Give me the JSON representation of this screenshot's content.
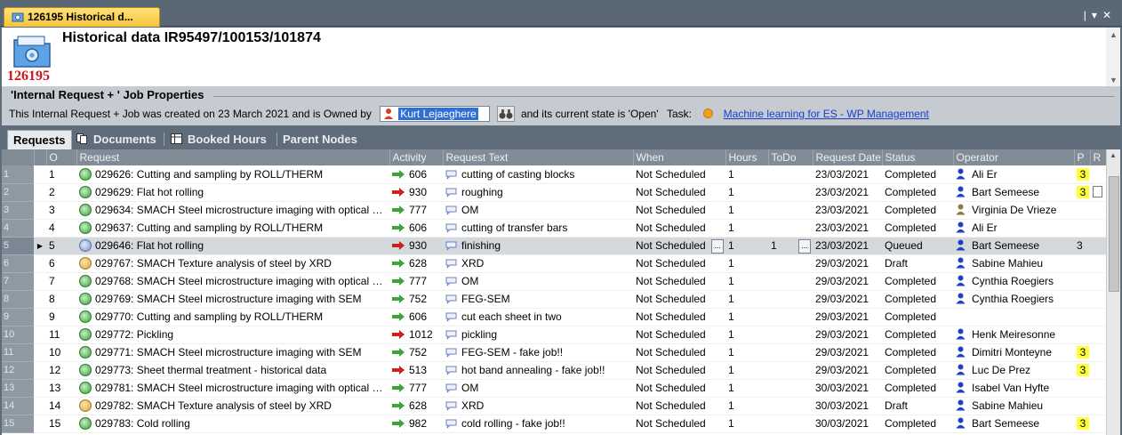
{
  "tab": {
    "label": "126195 Historical d..."
  },
  "header": {
    "title": "Historical data IR95497/100153/101874",
    "record_id": "126195"
  },
  "props": {
    "legend": "'Internal Request + ' Job Properties",
    "sentence_pre": "This Internal Request + Job was created on 23 March 2021 and is Owned by",
    "owner": "Kurt Lejaeghere",
    "sentence_post": "and its current state is 'Open'",
    "task_label": "Task:",
    "task_link": "Machine learning for ES - WP Management"
  },
  "section_tabs": [
    {
      "label": "Requests"
    },
    {
      "label": "Documents"
    },
    {
      "label": "Booked Hours"
    },
    {
      "label": "Parent Nodes"
    }
  ],
  "columns": [
    "O",
    "Request",
    "Activity",
    "Request Text",
    "When",
    "Hours",
    "ToDo",
    "Request Date",
    "Status",
    "Operator",
    "P",
    "R"
  ],
  "colors": {
    "arrow_green": "#3ea53e",
    "arrow_red": "#d0201a",
    "badge_yellow": "#ffff3c",
    "id_red": "#d0141c"
  },
  "rows": [
    {
      "n": "1",
      "o": "1",
      "req": "029626: Cutting and sampling by ROLL/THERM",
      "st_icon": "completed",
      "act": "606",
      "act_dir": "green",
      "text": "cutting of casting blocks",
      "when": "Not Scheduled",
      "hours": "1",
      "todo": "",
      "date": "23/03/2021",
      "status": "Completed",
      "op": "Ali Er",
      "op_color": "blue",
      "p": "3",
      "r": ""
    },
    {
      "n": "2",
      "o": "2",
      "req": "029629: Flat hot rolling",
      "st_icon": "completed",
      "act": "930",
      "act_dir": "red",
      "text": "roughing",
      "when": "Not Scheduled",
      "hours": "1",
      "todo": "",
      "date": "23/03/2021",
      "status": "Completed",
      "op": "Bart Semeese",
      "op_color": "blue",
      "p": "3",
      "r": "doc"
    },
    {
      "n": "3",
      "o": "3",
      "req": "029634: SMACH Steel microstructure imaging with optical microsco...",
      "st_icon": "completed",
      "act": "777",
      "act_dir": "green",
      "text": "OM",
      "when": "Not Scheduled",
      "hours": "1",
      "todo": "",
      "date": "23/03/2021",
      "status": "Completed",
      "op": "Virginia De Vrieze",
      "op_color": "olive",
      "p": "",
      "r": ""
    },
    {
      "n": "4",
      "o": "4",
      "req": "029637: Cutting and sampling by ROLL/THERM",
      "st_icon": "completed",
      "act": "606",
      "act_dir": "green",
      "text": "cutting of transfer bars",
      "when": "Not Scheduled",
      "hours": "1",
      "todo": "",
      "date": "23/03/2021",
      "status": "Completed",
      "op": "Ali Er",
      "op_color": "blue",
      "p": "",
      "r": ""
    },
    {
      "n": "5",
      "o": "5",
      "req": "029646: Flat hot rolling",
      "st_icon": "queued",
      "act": "930",
      "act_dir": "red",
      "text": "finishing",
      "when": "Not Scheduled",
      "hours": "1",
      "todo": "1",
      "date": "23/03/2021",
      "status": "Queued",
      "op": "Bart Semeese",
      "op_color": "blue",
      "p": "3",
      "r": "",
      "selected": true
    },
    {
      "n": "6",
      "o": "6",
      "req": "029767: SMACH Texture analysis of steel by XRD",
      "st_icon": "draft",
      "act": "628",
      "act_dir": "green",
      "text": "XRD",
      "when": "Not Scheduled",
      "hours": "1",
      "todo": "",
      "date": "29/03/2021",
      "status": "Draft",
      "op": "Sabine Mahieu",
      "op_color": "blue",
      "p": "",
      "r": ""
    },
    {
      "n": "7",
      "o": "7",
      "req": "029768: SMACH Steel microstructure imaging with optical microsco...",
      "st_icon": "completed",
      "act": "777",
      "act_dir": "green",
      "text": "OM",
      "when": "Not Scheduled",
      "hours": "1",
      "todo": "",
      "date": "29/03/2021",
      "status": "Completed",
      "op": "Cynthia Roegiers",
      "op_color": "blue",
      "p": "",
      "r": ""
    },
    {
      "n": "8",
      "o": "8",
      "req": "029769: SMACH Steel microstructure imaging with SEM",
      "st_icon": "completed",
      "act": "752",
      "act_dir": "green",
      "text": "FEG-SEM",
      "when": "Not Scheduled",
      "hours": "1",
      "todo": "",
      "date": "29/03/2021",
      "status": "Completed",
      "op": "Cynthia Roegiers",
      "op_color": "blue",
      "p": "",
      "r": ""
    },
    {
      "n": "9",
      "o": "9",
      "req": "029770: Cutting and sampling by ROLL/THERM",
      "st_icon": "completed",
      "act": "606",
      "act_dir": "green",
      "text": "cut each sheet in two",
      "when": "Not Scheduled",
      "hours": "1",
      "todo": "",
      "date": "29/03/2021",
      "status": "Completed",
      "op": "",
      "op_color": "",
      "p": "",
      "r": ""
    },
    {
      "n": "10",
      "o": "11",
      "req": "029772: Pickling",
      "st_icon": "completed",
      "act": "1012",
      "act_dir": "red",
      "text": "pickling",
      "when": "Not Scheduled",
      "hours": "1",
      "todo": "",
      "date": "29/03/2021",
      "status": "Completed",
      "op": "Henk Meiresonne",
      "op_color": "blue",
      "p": "",
      "r": ""
    },
    {
      "n": "11",
      "o": "10",
      "req": "029771: SMACH Steel microstructure imaging with SEM",
      "st_icon": "completed",
      "act": "752",
      "act_dir": "green",
      "text": "FEG-SEM - fake job!!",
      "when": "Not Scheduled",
      "hours": "1",
      "todo": "",
      "date": "29/03/2021",
      "status": "Completed",
      "op": "Dimitri Monteyne",
      "op_color": "blue",
      "p": "3",
      "r": ""
    },
    {
      "n": "12",
      "o": "12",
      "req": "029773: Sheet thermal treatment - historical data",
      "st_icon": "completed",
      "act": "513",
      "act_dir": "red",
      "text": "hot band annealing - fake job!!",
      "when": "Not Scheduled",
      "hours": "1",
      "todo": "",
      "date": "29/03/2021",
      "status": "Completed",
      "op": "Luc De Prez",
      "op_color": "blue",
      "p": "3",
      "r": ""
    },
    {
      "n": "13",
      "o": "13",
      "req": "029781: SMACH Steel microstructure imaging with optical microsco...",
      "st_icon": "completed",
      "act": "777",
      "act_dir": "green",
      "text": "OM",
      "when": "Not Scheduled",
      "hours": "1",
      "todo": "",
      "date": "30/03/2021",
      "status": "Completed",
      "op": "Isabel Van Hyfte",
      "op_color": "blue",
      "p": "",
      "r": ""
    },
    {
      "n": "14",
      "o": "14",
      "req": "029782: SMACH Texture analysis of steel by XRD",
      "st_icon": "draft",
      "act": "628",
      "act_dir": "green",
      "text": "XRD",
      "when": "Not Scheduled",
      "hours": "1",
      "todo": "",
      "date": "30/03/2021",
      "status": "Draft",
      "op": "Sabine Mahieu",
      "op_color": "blue",
      "p": "",
      "r": ""
    },
    {
      "n": "15",
      "o": "15",
      "req": "029783: Cold rolling",
      "st_icon": "completed",
      "act": "982",
      "act_dir": "green",
      "text": "cold rolling - fake job!!",
      "when": "Not Scheduled",
      "hours": "1",
      "todo": "",
      "date": "30/03/2021",
      "status": "Completed",
      "op": "Bart Semeese",
      "op_color": "blue",
      "p": "3",
      "r": ""
    }
  ]
}
